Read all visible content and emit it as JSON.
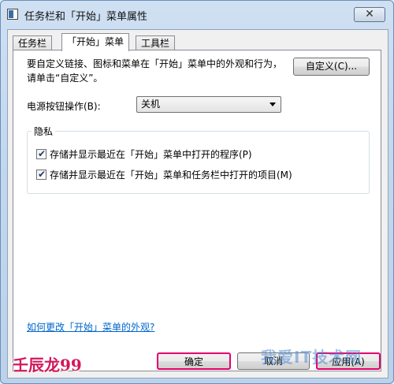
{
  "window": {
    "title": "任务栏和「开始」菜单属性",
    "close_label": "✕"
  },
  "tabs": [
    {
      "label": "任务栏",
      "active": false
    },
    {
      "label": "「开始」菜单",
      "active": true
    },
    {
      "label": "工具栏",
      "active": false
    }
  ],
  "panel": {
    "description": "要自定义链接、图标和菜单在「开始」菜单中的外观和行为，请单击“自定义”。",
    "customize_label": "自定义(C)...",
    "power_label": "电源按钮操作(B):",
    "power_value": "关机",
    "privacy": {
      "legend": "隐私",
      "items": [
        {
          "label": "存储并显示最近在「开始」菜单中打开的程序(P)",
          "checked": true
        },
        {
          "label": "存储并显示最近在「开始」菜单和任务栏中打开的项目(M)",
          "checked": true
        }
      ]
    },
    "help_link": "如何更改「开始」菜单的外观?"
  },
  "buttons": {
    "ok": "确定",
    "cancel": "取消",
    "apply": "应用(A)"
  },
  "overlay": {
    "author_mark": "壬辰龙99",
    "watermark": "我爱IT技术网"
  },
  "colors": {
    "highlight_border": "#e3006e",
    "link": "#0066cc"
  }
}
